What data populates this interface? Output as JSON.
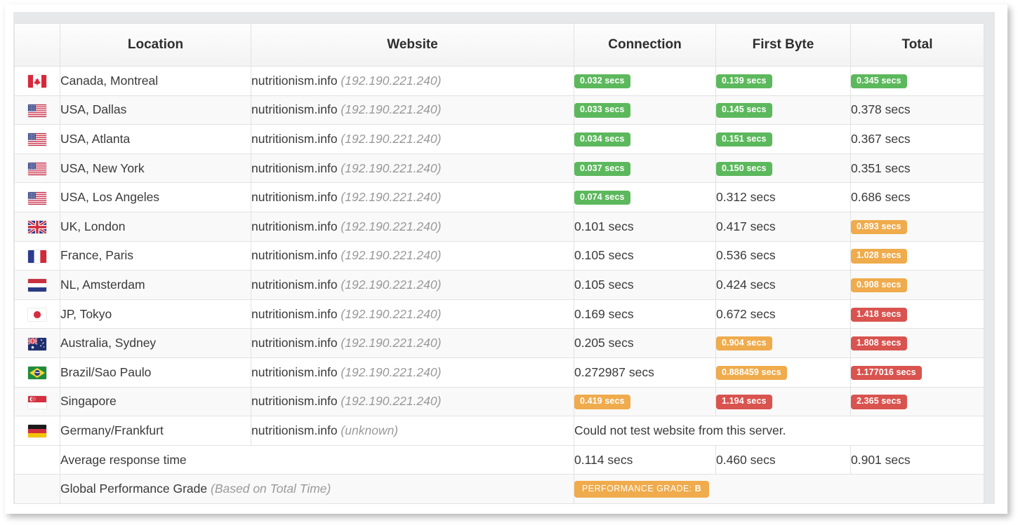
{
  "table": {
    "columns": [
      {
        "key": "flag",
        "label": ""
      },
      {
        "key": "location",
        "label": "Location"
      },
      {
        "key": "website",
        "label": "Website"
      },
      {
        "key": "connection",
        "label": "Connection"
      },
      {
        "key": "firstbyte",
        "label": "First Byte"
      },
      {
        "key": "total",
        "label": "Total"
      }
    ],
    "rows": [
      {
        "flag": "flag-ca",
        "flag_name": "flag-canada",
        "location": "Canada, Montreal",
        "site": "nutritionism.info",
        "ip": "(192.190.221.240)",
        "connection": {
          "text": "0.032 secs",
          "style": "good"
        },
        "firstbyte": {
          "text": "0.139 secs",
          "style": "good"
        },
        "total": {
          "text": "0.345 secs",
          "style": "good"
        }
      },
      {
        "flag": "flag-us",
        "flag_name": "flag-usa",
        "location": "USA, Dallas",
        "site": "nutritionism.info",
        "ip": "(192.190.221.240)",
        "connection": {
          "text": "0.033 secs",
          "style": "good"
        },
        "firstbyte": {
          "text": "0.145 secs",
          "style": "good"
        },
        "total": {
          "text": "0.378 secs",
          "style": "plain"
        }
      },
      {
        "flag": "flag-us",
        "flag_name": "flag-usa",
        "location": "USA, Atlanta",
        "site": "nutritionism.info",
        "ip": "(192.190.221.240)",
        "connection": {
          "text": "0.034 secs",
          "style": "good"
        },
        "firstbyte": {
          "text": "0.151 secs",
          "style": "good"
        },
        "total": {
          "text": "0.367 secs",
          "style": "plain"
        }
      },
      {
        "flag": "flag-us",
        "flag_name": "flag-usa",
        "location": "USA, New York",
        "site": "nutritionism.info",
        "ip": "(192.190.221.240)",
        "connection": {
          "text": "0.037 secs",
          "style": "good"
        },
        "firstbyte": {
          "text": "0.150 secs",
          "style": "good"
        },
        "total": {
          "text": "0.351 secs",
          "style": "plain"
        }
      },
      {
        "flag": "flag-us",
        "flag_name": "flag-usa",
        "location": "USA, Los Angeles",
        "site": "nutritionism.info",
        "ip": "(192.190.221.240)",
        "connection": {
          "text": "0.074 secs",
          "style": "good"
        },
        "firstbyte": {
          "text": "0.312 secs",
          "style": "plain"
        },
        "total": {
          "text": "0.686 secs",
          "style": "plain"
        }
      },
      {
        "flag": "flag-gb",
        "flag_name": "flag-united-kingdom",
        "location": "UK, London",
        "site": "nutritionism.info",
        "ip": "(192.190.221.240)",
        "connection": {
          "text": "0.101 secs",
          "style": "plain"
        },
        "firstbyte": {
          "text": "0.417 secs",
          "style": "plain"
        },
        "total": {
          "text": "0.893 secs",
          "style": "warn"
        }
      },
      {
        "flag": "flag-fr",
        "flag_name": "flag-france",
        "location": "France, Paris",
        "site": "nutritionism.info",
        "ip": "(192.190.221.240)",
        "connection": {
          "text": "0.105 secs",
          "style": "plain"
        },
        "firstbyte": {
          "text": "0.536 secs",
          "style": "plain"
        },
        "total": {
          "text": "1.028 secs",
          "style": "warn"
        }
      },
      {
        "flag": "flag-nl",
        "flag_name": "flag-netherlands",
        "location": "NL, Amsterdam",
        "site": "nutritionism.info",
        "ip": "(192.190.221.240)",
        "connection": {
          "text": "0.105 secs",
          "style": "plain"
        },
        "firstbyte": {
          "text": "0.424 secs",
          "style": "plain"
        },
        "total": {
          "text": "0.908 secs",
          "style": "warn"
        }
      },
      {
        "flag": "flag-jp",
        "flag_name": "flag-japan",
        "location": "JP, Tokyo",
        "site": "nutritionism.info",
        "ip": "(192.190.221.240)",
        "connection": {
          "text": "0.169 secs",
          "style": "plain"
        },
        "firstbyte": {
          "text": "0.672 secs",
          "style": "plain"
        },
        "total": {
          "text": "1.418 secs",
          "style": "bad"
        }
      },
      {
        "flag": "flag-au",
        "flag_name": "flag-australia",
        "location": "Australia, Sydney",
        "site": "nutritionism.info",
        "ip": "(192.190.221.240)",
        "connection": {
          "text": "0.205 secs",
          "style": "plain"
        },
        "firstbyte": {
          "text": "0.904 secs",
          "style": "warn"
        },
        "total": {
          "text": "1.808 secs",
          "style": "bad"
        }
      },
      {
        "flag": "flag-br",
        "flag_name": "flag-brazil",
        "location": "Brazil/Sao Paulo",
        "site": "nutritionism.info",
        "ip": "(192.190.221.240)",
        "connection": {
          "text": "0.272987 secs",
          "style": "plain"
        },
        "firstbyte": {
          "text": "0.888459 secs",
          "style": "warn"
        },
        "total": {
          "text": "1.177016 secs",
          "style": "bad"
        }
      },
      {
        "flag": "flag-sg",
        "flag_name": "flag-singapore",
        "location": "Singapore",
        "site": "nutritionism.info",
        "ip": "(192.190.221.240)",
        "connection": {
          "text": "0.419 secs",
          "style": "warn"
        },
        "firstbyte": {
          "text": "1.194 secs",
          "style": "bad"
        },
        "total": {
          "text": "2.365 secs",
          "style": "bad"
        }
      }
    ],
    "error_row": {
      "flag": "flag-de",
      "flag_name": "flag-germany",
      "location": "Germany/Frankfurt",
      "site": "nutritionism.info",
      "ip": "(unknown)",
      "message": "Could not test website from this server."
    },
    "average_row": {
      "label": "Average response time",
      "connection": "0.114 secs",
      "firstbyte": "0.460 secs",
      "total": "0.901 secs"
    },
    "grade_row": {
      "label": "Global Performance Grade",
      "label_note": "(Based on Total Time)",
      "badge_prefix": "PERFORMANCE GRADE:",
      "badge_grade": "B"
    }
  },
  "colors": {
    "good": "#5cb85c",
    "warn": "#efab4c",
    "bad": "#d9534f",
    "text": "#3a3a3a",
    "muted": "#999999",
    "frame": "#e7e8ea"
  }
}
